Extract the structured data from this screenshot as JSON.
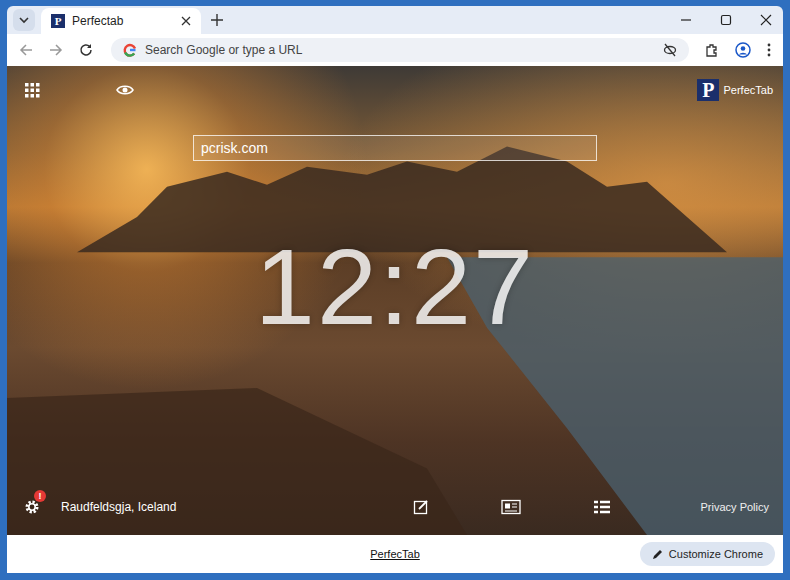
{
  "window": {
    "tabs": [
      {
        "label": "Perfectab",
        "selected": true
      }
    ]
  },
  "logo": "P",
  "toolbar": {
    "omnibox_placeholder": "Search Google or type a URL"
  },
  "page": {
    "search_value": "pcrisk.com",
    "brand": "PerfecTab",
    "clock": "12:27",
    "location": "Raudfeldsgja, Iceland",
    "privacy": "Privacy Policy",
    "settings_badge": "!"
  },
  "footer": {
    "link": "PerfecTab",
    "customize": "Customize Chrome"
  }
}
